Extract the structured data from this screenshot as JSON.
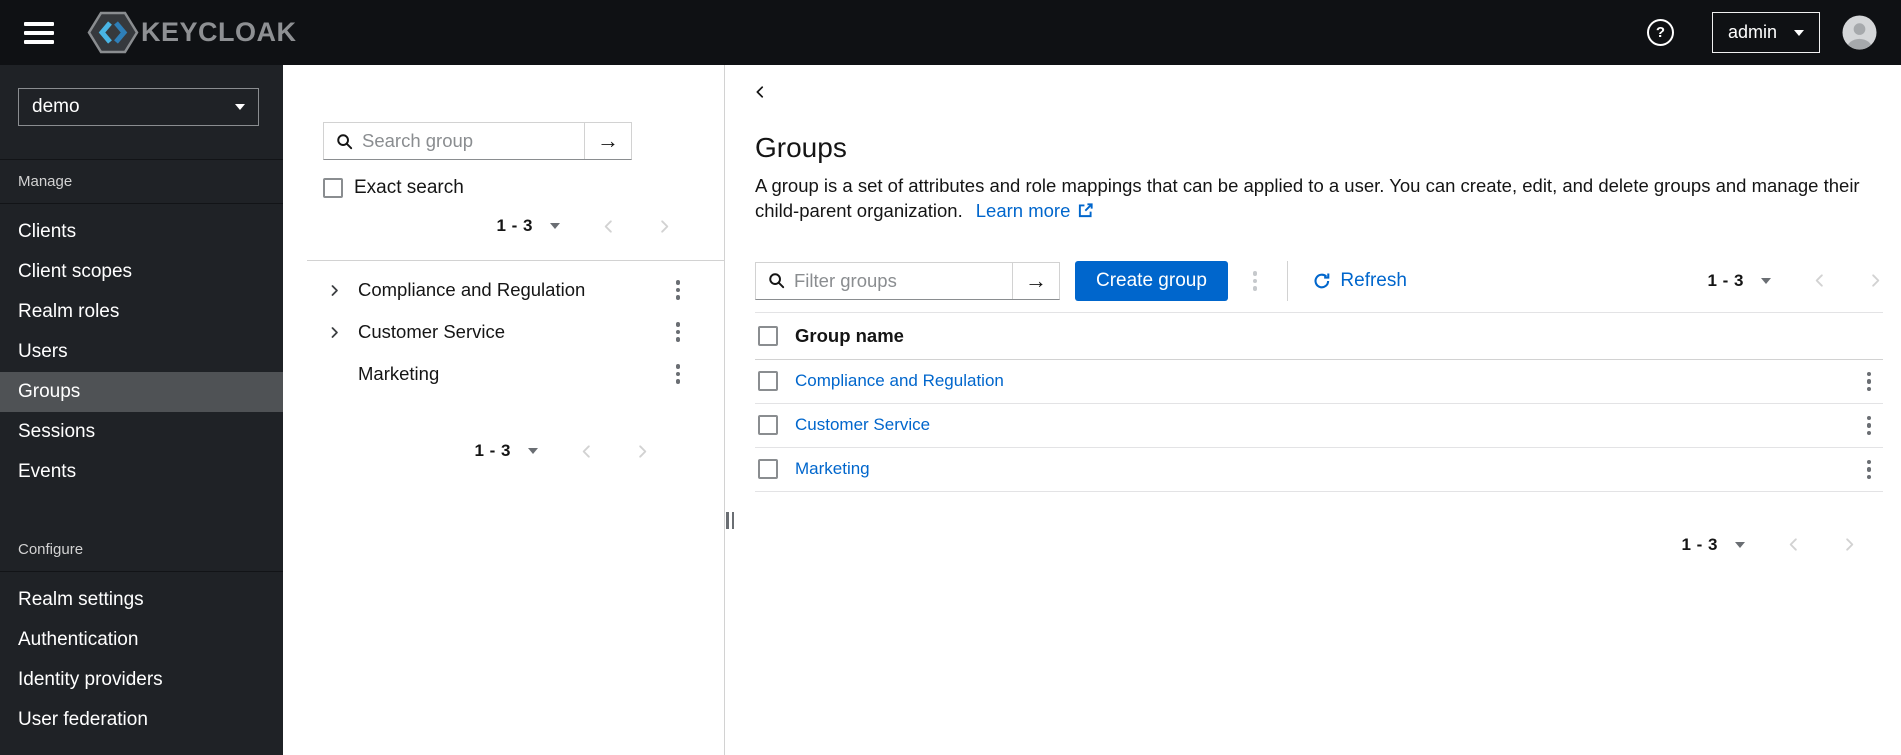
{
  "header": {
    "brand_text": "KEYCLOAK",
    "help_glyph": "?",
    "user_menu": {
      "label": "admin"
    }
  },
  "sidebar": {
    "realm_selector": {
      "value": "demo"
    },
    "sections": [
      {
        "label": "Manage",
        "items": [
          {
            "label": "Clients"
          },
          {
            "label": "Client scopes"
          },
          {
            "label": "Realm roles"
          },
          {
            "label": "Users"
          },
          {
            "label": "Groups",
            "active": true
          },
          {
            "label": "Sessions"
          },
          {
            "label": "Events"
          }
        ]
      },
      {
        "label": "Configure",
        "items": [
          {
            "label": "Realm settings"
          },
          {
            "label": "Authentication"
          },
          {
            "label": "Identity providers"
          },
          {
            "label": "User federation"
          }
        ]
      }
    ]
  },
  "group_tree_panel": {
    "search": {
      "placeholder": "Search group"
    },
    "exact_search_label": "Exact search",
    "pagination_top": {
      "range": "1 - 3"
    },
    "items": [
      {
        "name": "Compliance and Regulation",
        "expandable": true
      },
      {
        "name": "Customer Service",
        "expandable": true
      },
      {
        "name": "Marketing",
        "expandable": false
      }
    ],
    "pagination_bottom": {
      "range": "1 - 3"
    }
  },
  "main": {
    "page_title": "Groups",
    "description": "A group is a set of attributes and role mappings that can be applied to a user. You can create, edit, and delete groups and manage their child-parent organization.",
    "learn_more": {
      "label": "Learn more"
    },
    "toolbar": {
      "filter": {
        "placeholder": "Filter groups"
      },
      "create_button_label": "Create group",
      "refresh_label": "Refresh",
      "pagination": {
        "range": "1 - 3"
      }
    },
    "table": {
      "columns": [
        {
          "label": "Group name"
        }
      ],
      "rows": [
        {
          "name": "Compliance and Regulation"
        },
        {
          "name": "Customer Service"
        },
        {
          "name": "Marketing"
        }
      ]
    },
    "pagination_bottom": {
      "range": "1 - 3"
    }
  },
  "icons": {
    "arrow_right_glyph": "→"
  },
  "colors": {
    "header_bg": "#0f1114",
    "sidebar_bg": "#1f2226",
    "sidebar_active_bg": "#4f5255",
    "primary_blue": "#0066cc",
    "link_blue": "#0066cc",
    "border_gray": "#d2d2d2",
    "disabled_gray": "#d2d2d2",
    "logo_blue_light": "#49b5e5",
    "logo_blue_dark": "#2e7fb8"
  }
}
